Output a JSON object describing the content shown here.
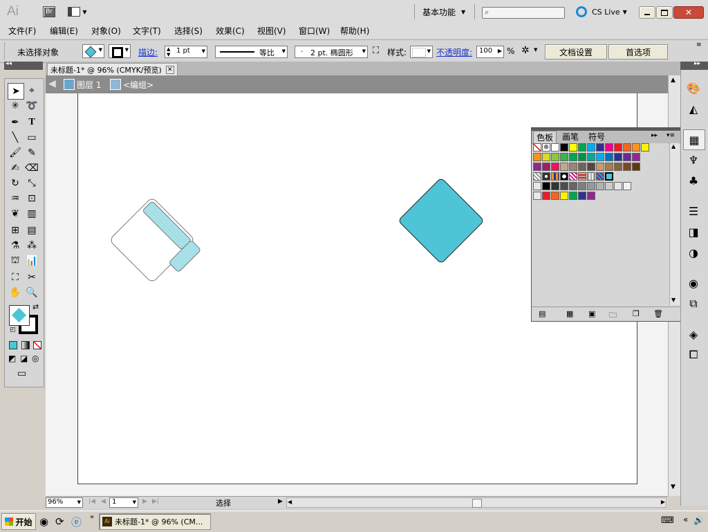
{
  "app": {
    "logo": "Ai",
    "bridge": "Br",
    "workspace_label": "基本功能",
    "search_placeholder": "",
    "cslive_label": "CS Live"
  },
  "menu": [
    "文件(F)",
    "编辑(E)",
    "对象(O)",
    "文字(T)",
    "选择(S)",
    "效果(C)",
    "视图(V)",
    "窗口(W)",
    "帮助(H)"
  ],
  "control": {
    "selection_label": "未选择对象",
    "stroke_label": "描边:",
    "stroke_value": "1 pt",
    "profile_label": "等比",
    "brush_label": "2 pt. 椭圆形",
    "style_label": "样式:",
    "opacity_label": "不透明度:",
    "opacity_value": "100",
    "percent_sign": "%",
    "doc_settings": "文档设置",
    "preferences": "首选项"
  },
  "document": {
    "tab_title": "未标题-1* @ 96% (CMYK/预览)",
    "layer_label": "图层 1",
    "group_label": "<编组>"
  },
  "swatch_panel": {
    "tabs": [
      "色板",
      "画笔",
      "符号"
    ],
    "colors_row1": [
      "#ffffff",
      "#000000",
      "#ffff00",
      "#00a651",
      "#00aeef",
      "#2e3192",
      "#ec008c",
      "#ed1c24",
      "#f26522",
      "#f7941d",
      "#fff200"
    ],
    "colors_row2": [
      "#f7941d",
      "#d7df23",
      "#8dc63f",
      "#39b54a",
      "#00a651",
      "#009444",
      "#00a99d",
      "#00aeef",
      "#0072bc",
      "#2e3192",
      "#662d91",
      "#92278f"
    ],
    "colors_row3": [
      "#92278f",
      "#9e1f63",
      "#ed145b",
      "#c2a88c",
      "#998675",
      "#736357",
      "#534741",
      "#c69c6d",
      "#a67c52",
      "#8c6239",
      "#754c24",
      "#603913"
    ],
    "gray_row": [
      "#000000",
      "#333333",
      "#4d4d4d",
      "#666666",
      "#808080",
      "#999999",
      "#b3b3b3",
      "#cccccc",
      "#e6e6e6",
      "#f2f2f2"
    ],
    "bright_row": [
      "#ed1c24",
      "#f26522",
      "#fff200",
      "#00a651",
      "#2e3192",
      "#92278f"
    ],
    "fill_color": "#4ec5d6"
  },
  "status": {
    "zoom": "96%",
    "page": "1",
    "mode": "选择"
  },
  "taskbar": {
    "start": "开始",
    "task_label": "未标题-1* @ 96% (CM..."
  },
  "artwork": {
    "shape1_light": "#a8e0e8",
    "shape2_fill": "#4ec5d6"
  }
}
